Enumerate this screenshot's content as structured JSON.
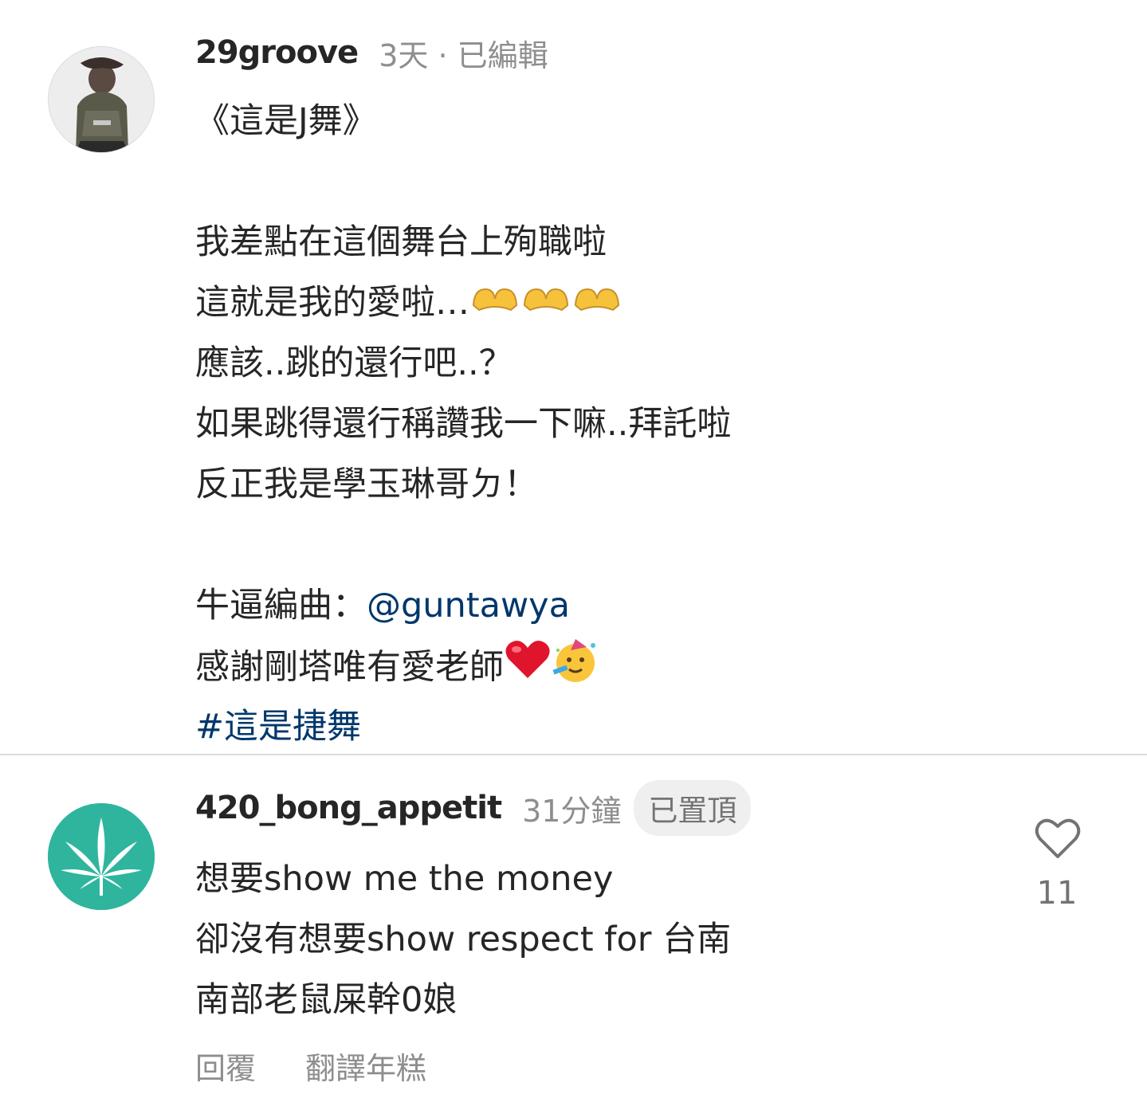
{
  "post": {
    "username": "29groove",
    "meta": "3天 · 已編輯",
    "lines": {
      "l1": "《這是J舞》",
      "l2": "我差點在這個舞台上殉職啦",
      "l3_text": "這就是我的愛啦…",
      "l3_emoji": "heart-hands-emoji",
      "l4": "應該..跳的還行吧..？",
      "l5": "如果跳得還行稱讚我一下嘛..拜託啦",
      "l6": "反正我是學玉琳哥ㄉ！",
      "l7_prefix": "牛逼編曲：",
      "l7_mention": "@guntawya",
      "l8_text": "感謝剛塔唯有愛老師",
      "l8_emojis": [
        "red-heart-emoji",
        "partying-face-emoji"
      ],
      "l9_hashtag": "#這是捷舞"
    }
  },
  "comment": {
    "username": "420_bong_appetit",
    "time": "31分鐘",
    "pinned": "已置頂",
    "lines": [
      "想要show me the money",
      "卻沒有想要show respect for 台南",
      "南部老鼠屎幹0娘"
    ],
    "like_icon": "heart-outline-icon",
    "likes": "11",
    "reply_label": "回覆",
    "translate_label": "翻譯年糕"
  },
  "colors": {
    "text": "#262626",
    "secondary": "#8e8e8e",
    "link": "#00376b",
    "avatar_green": "#2fb59e"
  }
}
